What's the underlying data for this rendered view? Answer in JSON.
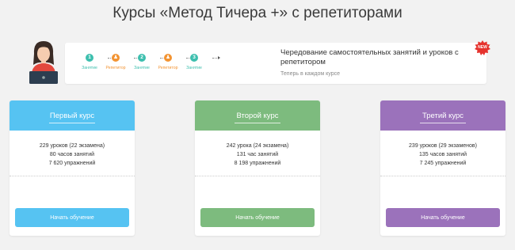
{
  "page": {
    "title": "Курсы «Метод Тичера +» с репетиторами"
  },
  "banner": {
    "steps": [
      {
        "number": "1",
        "label": "Занятие",
        "kind": "lesson"
      },
      {
        "number": "♟",
        "label": "Репетитор",
        "kind": "tutor"
      },
      {
        "number": "2",
        "label": "Занятие",
        "kind": "lesson"
      },
      {
        "number": "♟",
        "label": "Репетитор",
        "kind": "tutor"
      },
      {
        "number": "3",
        "label": "Занятие",
        "kind": "lesson"
      }
    ],
    "title": "Чередование самостоятельных занятий и уроков с репетитором",
    "subtitle": "Теперь в каждом курсе",
    "badge": "NEW",
    "badge_color": "#e5322d",
    "lesson_color": "#3dbfae",
    "tutor_color": "#f39433"
  },
  "courses": [
    {
      "name": "Первый курс",
      "color": "#56c3f2",
      "stats": [
        "229 уроков (22 экзамена)",
        "80 часов занятий",
        "7 620 упражнений"
      ],
      "button": "Начать обучение"
    },
    {
      "name": "Второй курс",
      "color": "#7dbb7e",
      "stats": [
        "242 урока (24 экзамена)",
        "131 час занятий",
        "8 198 упражнений"
      ],
      "button": "Начать обучение"
    },
    {
      "name": "Третий курс",
      "color": "#9b72bb",
      "stats": [
        "239 уроков (29 экзаменов)",
        "135 часов занятий",
        "7 245 упражнений"
      ],
      "button": "Начать обучение"
    }
  ]
}
